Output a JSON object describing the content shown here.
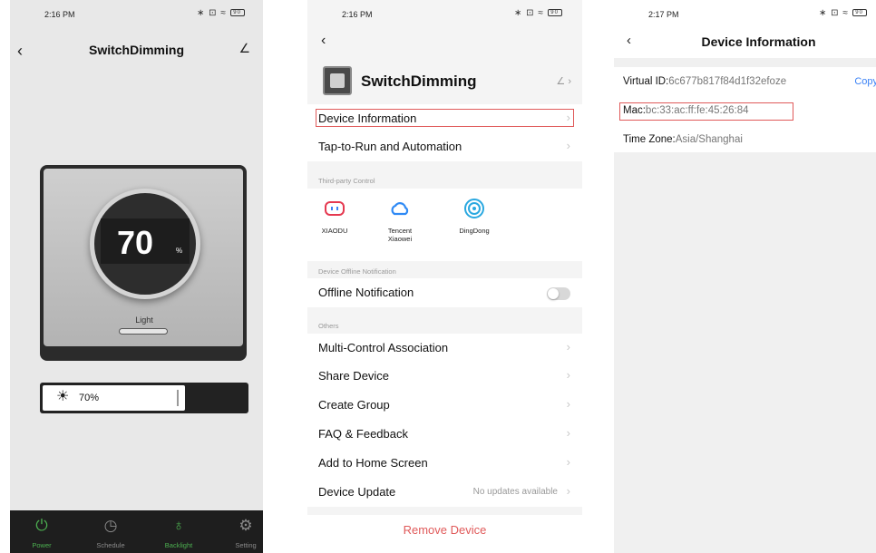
{
  "panel1": {
    "status": {
      "time": "2:16 PM",
      "icons": "∗ ⊡ ≈",
      "battery": "90"
    },
    "header": {
      "title": "SwitchDimming",
      "back_icon": "‹",
      "edit_icon": "∠"
    },
    "device": {
      "value": "70",
      "unit": "%",
      "light_label": "Light"
    },
    "brightness": {
      "icon": "☀",
      "label": "70%",
      "level_percent": 70
    },
    "nav": [
      {
        "label": "Power",
        "icon": "⏻",
        "active": true
      },
      {
        "label": "Schedule",
        "icon": "◷",
        "active": false
      },
      {
        "label": "Backlight",
        "icon": "♁",
        "active": true
      },
      {
        "label": "Setting",
        "icon": "⚙",
        "active": false
      }
    ],
    "colors": {
      "active": "#4caf50",
      "inactive": "#8a8a8a"
    }
  },
  "panel2": {
    "status": {
      "time": "2:16 PM",
      "icons": "∗ ⊡ ≈",
      "battery": "90"
    },
    "back_icon": "‹",
    "device_name": "SwitchDimming",
    "edit_icon": "∠ ›",
    "rows_top": [
      {
        "label": "Device Information"
      },
      {
        "label": "Tap-to-Run and Automation"
      }
    ],
    "section_third_party": "Third-party Control",
    "third_party": [
      {
        "label": "XIAODU"
      },
      {
        "label": "Tencent Xiaowei"
      },
      {
        "label": "DingDong"
      }
    ],
    "section_offline": "Device Offline Notification",
    "offline_label": "Offline Notification",
    "section_others": "Others",
    "others": [
      {
        "label": "Multi-Control Association",
        "right": ""
      },
      {
        "label": "Share Device",
        "right": ""
      },
      {
        "label": "Create Group",
        "right": ""
      },
      {
        "label": "FAQ & Feedback",
        "right": ""
      },
      {
        "label": "Add to Home Screen",
        "right": ""
      },
      {
        "label": "Device Update",
        "right": "No updates available"
      }
    ],
    "remove": "Remove Device",
    "chevron": "›"
  },
  "panel3": {
    "status": {
      "time": "2:17 PM",
      "icons": "∗ ⊡ ≈",
      "battery": "90"
    },
    "back_icon": "‹",
    "title": "Device Information",
    "virtual_id": {
      "key": "Virtual ID:",
      "value": "6c677b817f84d1f32efoze"
    },
    "copy": "Copy",
    "mac": {
      "key": "Mac:",
      "value": "bc:33:ac:ff:fe:45:26:84"
    },
    "timezone": {
      "key": "Time Zone:",
      "value": "Asia/Shanghai"
    }
  }
}
